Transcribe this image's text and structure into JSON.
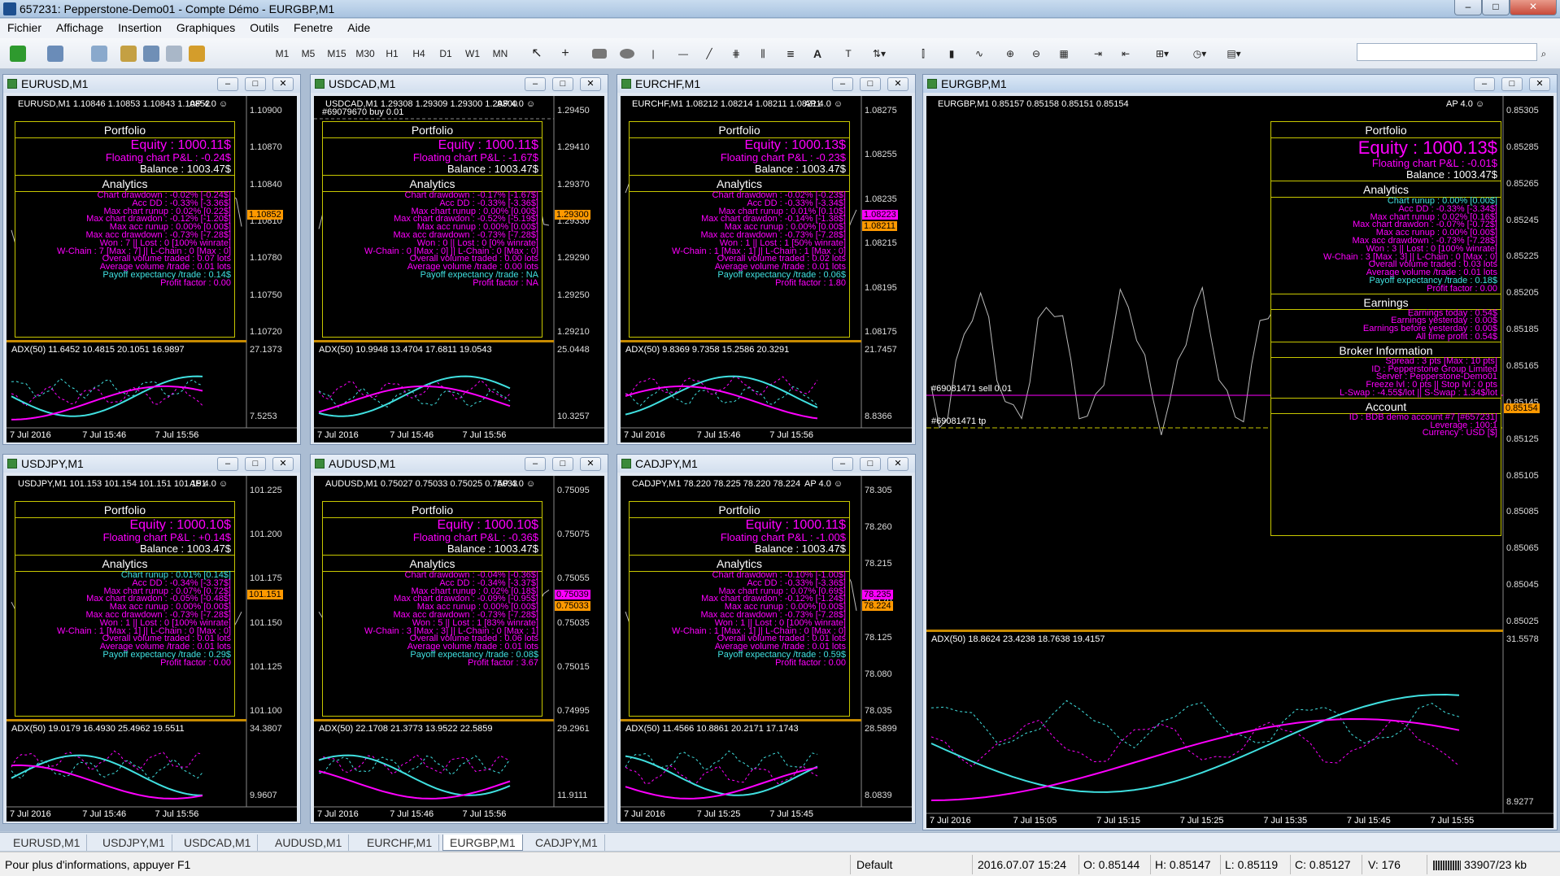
{
  "window": {
    "title": "657231: Pepperstone-Demo01 - Compte Démo - EURGBP,M1",
    "buttons": [
      "–",
      "□",
      "✕"
    ]
  },
  "menu": [
    "Fichier",
    "Affichage",
    "Insertion",
    "Graphiques",
    "Outils",
    "Fenetre",
    "Aide"
  ],
  "toolbar": {
    "timeframes": [
      "M1",
      "M5",
      "M15",
      "M30",
      "H1",
      "H4",
      "D1",
      "W1",
      "MN"
    ],
    "text_tool": "A"
  },
  "colors": {
    "accent": "#ff00ff",
    "cyan": "#40e0e0",
    "panel_border": "#c7c700",
    "price_tag": "#ff9900"
  },
  "charts": [
    {
      "id": "eurusd",
      "caption": "EURUSD,M1",
      "sym": "EURUSD,M1  1.10846 1.10853 1.10843 1.10852",
      "ea": "AP 4.0 ☺",
      "prices": [
        "1.10900",
        "1.10870",
        "1.10840",
        "1.10810",
        "1.10780",
        "1.10750",
        "1.10720"
      ],
      "price_tags": [
        "1.10852"
      ],
      "portfolio": {
        "equity": "Equity : 1000.11$",
        "floating": "Floating chart P&L : -0.24$",
        "balance": "Balance : 1003.47$"
      },
      "stats": [
        "Chart drawdown : -0.02% [-0.24$]",
        "Acc DD : -0.33% [-3.36$]",
        "Max chart runup : 0.02% [0.22$]",
        "Max chart drawdon : -0.12% [-1.20$]",
        "Max acc runup : 0.00% [0.00$]",
        "Max acc drawdown : -0.73% [-7.28$]",
        "Won : 7 || Lost : 0 [100% winrate]",
        "W-Chain : 7 [Max : 7] || L-Chain : 0 [Max : 0]",
        "Overall volume traded : 0.07 lots",
        "Average volume /trade : 0.01 lots",
        "Payoff expectancy /trade : 0.14$",
        "Profit factor : 0.00"
      ],
      "adx": {
        "label": "ADX(50) 11.6452 10.4815 20.1051 16.9897",
        "top": "27.1373",
        "bottom": "7.5253"
      },
      "times": [
        "7 Jul 2016",
        "7 Jul 15:46",
        "7 Jul 15:56"
      ]
    },
    {
      "id": "usdcad",
      "caption": "USDCAD,M1",
      "sym": "USDCAD,M1  1.29308 1.29309 1.29300 1.29300",
      "ea": "AP 4.0 ☺",
      "prices": [
        "1.29450",
        "1.29410",
        "1.29370",
        "1.29330",
        "1.29290",
        "1.29250",
        "1.29210"
      ],
      "price_tags": [
        "1.29300"
      ],
      "line_label": "#69079670 buy 0.01",
      "portfolio": {
        "equity": "Equity : 1000.11$",
        "floating": "Floating chart P&L : -1.67$",
        "balance": "Balance : 1003.47$"
      },
      "stats": [
        "Chart drawdown : -0.17% [-1.67$]",
        "Acc DD : -0.33% [-3.36$]",
        "Max chart runup : 0.00% [0.00$]",
        "Max chart drawdon : -0.52% [-5.19$]",
        "Max acc runup : 0.00% [0.00$]",
        "Max acc drawdown : -0.73% [-7.28$]",
        "Won : 0 || Lost : 0 [0% winrate]",
        "W-Chain : 0 [Max : 0] || L-Chain : 0 [Max : 0]",
        "Overall volume traded : 0.00 lots",
        "Average volume /trade : 0.00 lots",
        "Payoff expectancy /trade : NA",
        "Profit factor : NA"
      ],
      "adx": {
        "label": "ADX(50) 10.9948 13.4704 17.6811 19.0543",
        "top": "25.0448",
        "bottom": "10.3257"
      },
      "times": [
        "7 Jul 2016",
        "7 Jul 15:46",
        "7 Jul 15:56"
      ]
    },
    {
      "id": "eurchf",
      "caption": "EURCHF,M1",
      "sym": "EURCHF,M1  1.08212 1.08214 1.08211 1.08211",
      "ea": "AP 4.0 ☺",
      "prices": [
        "1.08275",
        "1.08255",
        "1.08235",
        "1.08215",
        "1.08195",
        "1.08175"
      ],
      "price_tags": [
        "1.08223",
        "1.08211"
      ],
      "portfolio": {
        "equity": "Equity : 1000.13$",
        "floating": "Floating chart P&L : -0.23$",
        "balance": "Balance : 1003.47$"
      },
      "stats": [
        "Chart drawdown : -0.02% [-0.23$]",
        "Acc DD : -0.33% [-3.34$]",
        "Max chart runup : 0.01% [0.10$]",
        "Max chart drawdon : -0.14% [-1.38$]",
        "Max acc runup : 0.00% [0.00$]",
        "Max acc drawdown : -0.73% [-7.28$]",
        "Won : 1 || Lost : 1 [50% winrate]",
        "W-Chain : 1 [Max : 1] || L-Chain : 1 [Max : 0]",
        "Overall volume traded : 0.02 lots",
        "Average volume /trade : 0.01 lots",
        "Payoff expectancy /trade : 0.06$",
        "Profit factor : 1.80"
      ],
      "adx": {
        "label": "ADX(50) 9.8369 9.7358 15.2586 20.3291",
        "top": "21.7457",
        "bottom": "8.8366"
      },
      "times": [
        "7 Jul 2016",
        "7 Jul 15:46",
        "7 Jul 15:56"
      ]
    },
    {
      "id": "usdjpy",
      "caption": "USDJPY,M1",
      "sym": "USDJPY,M1  101.153 101.154 101.151 101.151",
      "ea": "AP 4.0 ☺",
      "prices": [
        "101.225",
        "101.200",
        "101.175",
        "101.150",
        "101.125",
        "101.100"
      ],
      "price_tags": [
        "101.151"
      ],
      "portfolio": {
        "equity": "Equity : 1000.10$",
        "floating": "Floating chart P&L : +0.14$",
        "balance": "Balance : 1003.47$"
      },
      "stats": [
        "Chart runup : 0.01% [0.14$]",
        "Acc DD : -0.34% [-3.37$]",
        "Max chart runup : 0.07% [0.72$]",
        "Max chart drawdon : -0.05% [-0.48$]",
        "Max acc runup : 0.00% [0.00$]",
        "Max acc drawdown : -0.73% [-7.28$]",
        "Won : 1 || Lost : 0 [100% winrate]",
        "W-Chain : 1 [Max : 1] || L-Chain : 0 [Max : 0]",
        "Overall volume traded : 0.01 lots",
        "Average volume /trade : 0.01 lots",
        "Payoff expectancy /trade : 0.29$",
        "Profit factor : 0.00"
      ],
      "adx": {
        "label": "ADX(50) 19.0179 16.4930 25.4962 19.5511",
        "top": "34.3807",
        "bottom": "9.9607"
      },
      "times": [
        "7 Jul 2016",
        "7 Jul 15:46",
        "7 Jul 15:56"
      ]
    },
    {
      "id": "audusd",
      "caption": "AUDUSD,M1",
      "sym": "AUDUSD,M1  0.75027 0.75033 0.75025 0.75033",
      "ea": "AP 4.0 ☺",
      "prices": [
        "0.75095",
        "0.75075",
        "0.75055",
        "0.75035",
        "0.75015",
        "0.74995"
      ],
      "price_tags": [
        "0.75039",
        "0.75033"
      ],
      "portfolio": {
        "equity": "Equity : 1000.10$",
        "floating": "Floating chart P&L : -0.36$",
        "balance": "Balance : 1003.47$"
      },
      "stats": [
        "Chart drawdown : -0.04% [-0.36$]",
        "Acc DD : -0.34% [-3.37$]",
        "Max chart runup : 0.02% [0.18$]",
        "Max chart drawdon : -0.09% [-0.95$]",
        "Max acc runup : 0.00% [0.00$]",
        "Max acc drawdown : -0.73% [-7.28$]",
        "Won : 5 || Lost : 1 [83% winrate]",
        "W-Chain : 3 [Max : 3] || L-Chain : 0 [Max : 1]",
        "Overall volume traded : 0.06 lots",
        "Average volume /trade : 0.01 lots",
        "Payoff expectancy /trade : 0.08$",
        "Profit factor : 3.67"
      ],
      "adx": {
        "label": "ADX(50) 22.1708 21.3773 13.9522 22.5859",
        "top": "29.2961",
        "bottom": "11.9111"
      },
      "times": [
        "7 Jul 2016",
        "7 Jul 15:46",
        "7 Jul 15:56"
      ]
    },
    {
      "id": "cadjpy",
      "caption": "CADJPY,M1",
      "sym": "CADJPY,M1  78.220 78.225 78.220 78.224",
      "ea": "AP 4.0 ☺",
      "prices": [
        "78.305",
        "78.260",
        "78.215",
        "78.170",
        "78.125",
        "78.080",
        "78.035"
      ],
      "price_tags": [
        "78.235",
        "78.224"
      ],
      "portfolio": {
        "equity": "Equity : 1000.11$",
        "floating": "Floating chart P&L : -1.00$",
        "balance": "Balance : 1003.47$"
      },
      "stats": [
        "Chart drawdown : -0.10% [-1.00$]",
        "Acc DD : -0.33% [-3.36$]",
        "Max chart runup : 0.07% [0.69$]",
        "Max chart drawdon : -0.12% [-1.24$]",
        "Max acc runup : 0.00% [0.00$]",
        "Max acc drawdown : -0.73% [-7.28$]",
        "Won : 1 || Lost : 0 [100% winrate]",
        "W-Chain : 1 [Max : 1] || L-Chain : 0 [Max : 0]",
        "Overall volume traded : 0.01 lots",
        "Average volume /trade : 0.01 lots",
        "Payoff expectancy /trade : 0.59$",
        "Profit factor : 0.00"
      ],
      "adx": {
        "label": "ADX(50) 11.4566 10.8861 20.2171 17.1743",
        "top": "28.5899",
        "bottom": "8.0839"
      },
      "times": [
        "7 Jul 2016",
        "7 Jul 15:25",
        "7 Jul 15:45"
      ]
    }
  ],
  "big": {
    "caption": "EURGBP,M1",
    "sym": "EURGBP,M1  0.85157 0.85158 0.85151 0.85154",
    "ea": "AP 4.0 ☺",
    "prices": [
      "0.85305",
      "0.85285",
      "0.85265",
      "0.85245",
      "0.85225",
      "0.85205",
      "0.85185",
      "0.85165",
      "0.85145",
      "0.85125",
      "0.85105",
      "0.85085",
      "0.85065",
      "0.85045",
      "0.85025"
    ],
    "price_tags": [
      "0.85154"
    ],
    "sell_label": "#69081471 sell 0.01",
    "tp_label": "#69081471 tp",
    "portfolio": {
      "equity": "Equity : 1000.13$",
      "floating": "Floating chart P&L : -0.01$",
      "balance": "Balance : 1003.47$"
    },
    "stats": [
      "Chart runup : 0.00% [0.00$]",
      "Acc DD : -0.33% [-3.34$]",
      "Max chart runup : 0.02% [0.16$]",
      "Max chart drawdon : -0.07% [-0.72$]",
      "Max acc runup : 0.00% [0.00$]",
      "Max acc drawdown : -0.73% [-7.28$]",
      "Won : 3 || Lost : 0 [100% winrate]",
      "W-Chain : 3 [Max : 3] || L-Chain : 0 [Max : 0]",
      "Overall volume traded : 0.03 lots",
      "Average volume /trade : 0.01 lots",
      "Payoff expectancy /trade : 0.18$",
      "Profit factor : 0.00"
    ],
    "earnings": [
      "Earnings today : 0.54$",
      "Earnings yesterday : 0.00$",
      "Earnings before yesterday : 0.00$",
      "All time profit : 0.54$"
    ],
    "broker": [
      "Spread : 3 pts [Max : 10 pts]",
      "ID : Pepperstone Group Limited",
      "Server : Pepperstone-Demo01",
      "Freeze lvl : 0 pts || Stop lvl : 0 pts",
      "L-Swap : -4.55$/lot || S-Swap : 1.34$/lot"
    ],
    "account": [
      "ID : BDB demo account #7 [#657231]",
      "Leverage : 100:1",
      "Currency : USD [$]"
    ],
    "adx": {
      "label": "ADX(50) 18.8624 23.4238 18.7638 19.4157",
      "top": "31.5578",
      "bottom": "8.9277"
    },
    "times": [
      "7 Jul 2016",
      "7 Jul 15:05",
      "7 Jul 15:15",
      "7 Jul 15:25",
      "7 Jul 15:35",
      "7 Jul 15:45",
      "7 Jul 15:55"
    ]
  },
  "panel_titles": {
    "portfolio": "Portfolio",
    "analytics": "Analytics",
    "earnings": "Earnings",
    "broker": "Broker Information",
    "account": "Account"
  },
  "tabs": [
    "EURUSD,M1",
    "USDJPY,M1",
    "USDCAD,M1",
    "AUDUSD,M1",
    "EURCHF,M1",
    "EURGBP,M1",
    "CADJPY,M1"
  ],
  "status": {
    "help": "Pour plus d'informations, appuyer F1",
    "profile": "Default",
    "time": "2016.07.07 15:24",
    "o": "O: 0.85144",
    "h": "H: 0.85147",
    "l": "L: 0.85119",
    "c": "C: 0.85127",
    "v": "V: 176",
    "traffic": "33907/23 kb"
  }
}
